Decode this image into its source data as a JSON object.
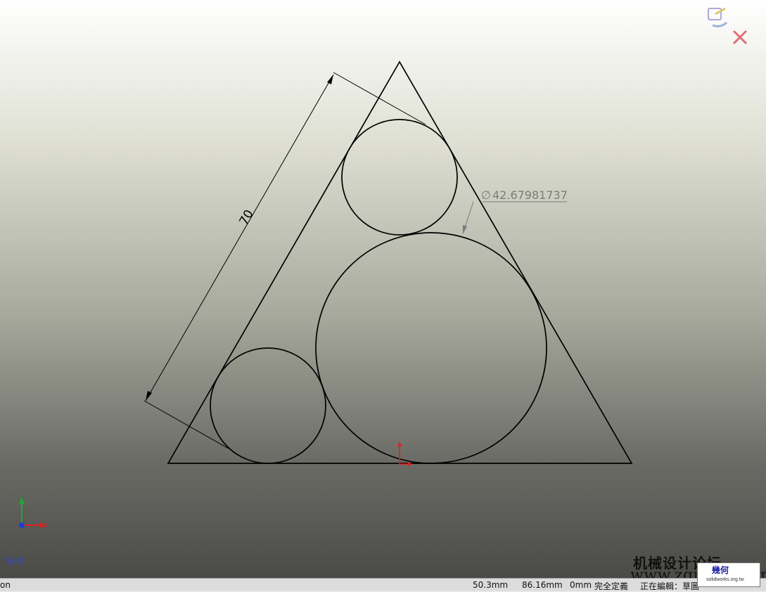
{
  "window": {
    "tab_fragment": "on"
  },
  "sketch": {
    "dimension_linear": "70",
    "dimension_diameter": "42.67981737",
    "diameter_symbol": "∅"
  },
  "view": {
    "name": "*前視"
  },
  "heads_up_icons": [
    "confirmation-corner-sketch-icon",
    "exit-sketch-icon"
  ],
  "status": {
    "x_coord": "50.3mm",
    "y_coord": "86.16mm",
    "z_coord": "0mm",
    "definition": "完全定義",
    "editing": "正在編輯：草圖"
  },
  "watermark": {
    "cn_text": "机械设计论坛",
    "url": "www.zgjxcad.com",
    "logo_text": "幾何",
    "logo_sub": "solidworks.org.tw"
  },
  "colors": {
    "origin_red": "#e0201a",
    "axis_green": "#1faa30",
    "axis_blue": "#1f3fd0",
    "dim_gray": "#7b7b7b"
  }
}
